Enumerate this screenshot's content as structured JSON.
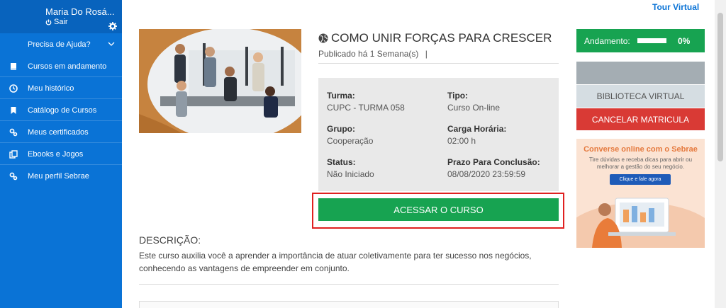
{
  "user": {
    "name": "Maria Do Rosá...",
    "logout_label": "Sair"
  },
  "sidebar": {
    "help_label": "Precisa de Ajuda?",
    "items": [
      {
        "label": "Cursos em andamento",
        "icon": "book-icon"
      },
      {
        "label": "Meu histórico",
        "icon": "clock-icon"
      },
      {
        "label": "Catálogo de Cursos",
        "icon": "bookmark-icon"
      },
      {
        "label": "Meus certificados",
        "icon": "certificate-icon"
      },
      {
        "label": "Ebooks e Jogos",
        "icon": "ebook-icon"
      },
      {
        "label": "Meu perfil Sebrae",
        "icon": "profile-icon"
      }
    ]
  },
  "header": {
    "tour_label": "Tour Virtual"
  },
  "course": {
    "title": "COMO UNIR FORÇAS PARA CRESCER",
    "published": "Publicado há 1 Semana(s)",
    "published_sep": "|",
    "info": {
      "turma_label": "Turma:",
      "turma_value": "CUPC - TURMA 058",
      "tipo_label": "Tipo:",
      "tipo_value": "Curso On-line",
      "grupo_label": "Grupo:",
      "grupo_value": "Cooperação",
      "carga_label": "Carga Horária:",
      "carga_value": "02:00 h",
      "status_label": "Status:",
      "status_value": "Não Iniciado",
      "prazo_label": "Prazo Para Conclusão:",
      "prazo_value": "08/08/2020 23:59:59"
    },
    "access_label": "ACESSAR O CURSO",
    "description_heading": "DESCRIÇÃO:",
    "description": "Este curso auxilia você a aprender a importância de atuar coletivamente para ter sucesso nos negócios, conhecendo as vantagens de empreender em conjunto."
  },
  "right": {
    "progress_label": "Andamento:",
    "progress_percent": "0%",
    "progress_value": 0,
    "library_label": "BIBLIOTECA VIRTUAL",
    "cancel_label": "CANCELAR MATRICULA"
  },
  "promo": {
    "title": "Converse online com o Sebrae",
    "subtitle": "Tire dúvidas e receba dicas para abrir ou melhorar a gestão do seu negócio.",
    "button_label": "Clique e fale agora"
  },
  "colors": {
    "sidebar": "#0a73d6",
    "green": "#17a351",
    "red": "#d93a35",
    "highlight": "#e02020"
  }
}
